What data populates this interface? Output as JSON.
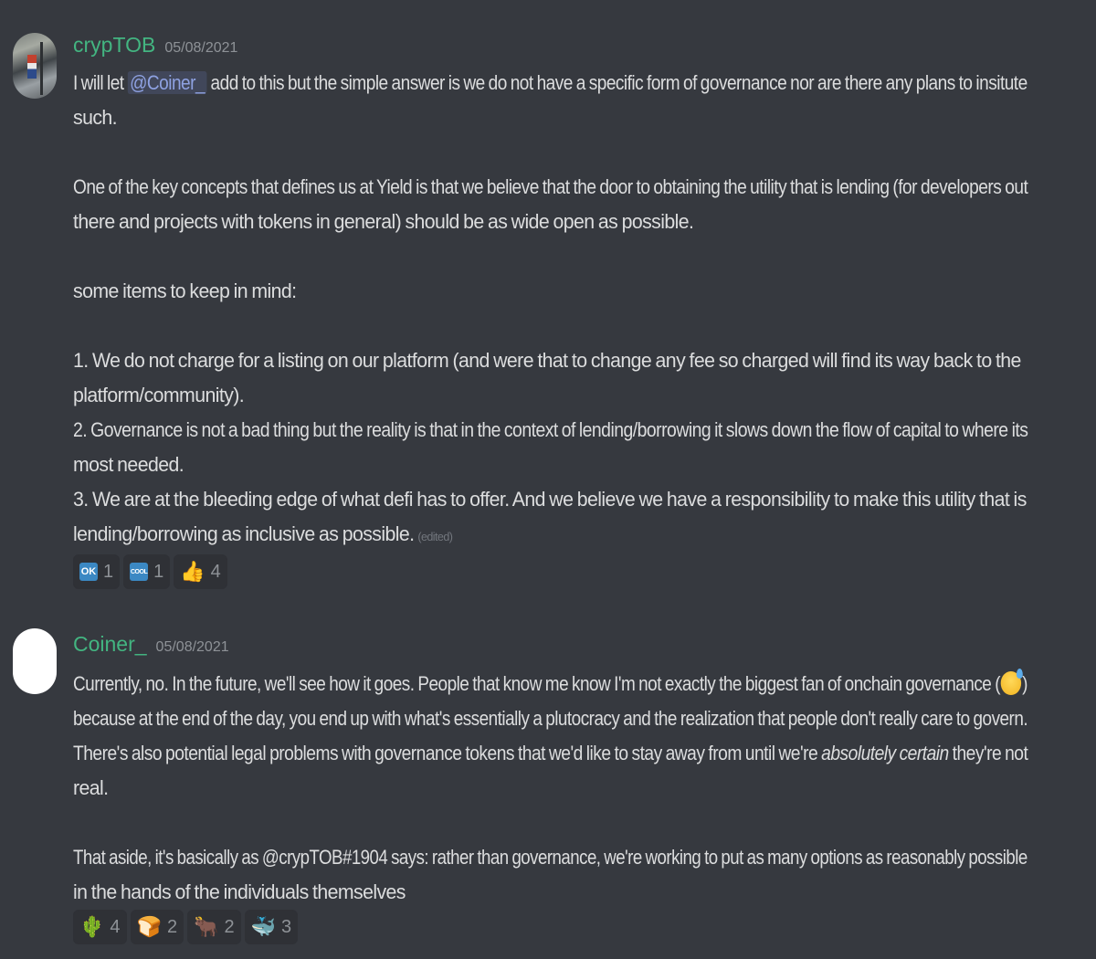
{
  "messages": [
    {
      "username": "crypTOB",
      "timestamp": "05/08/2021",
      "username_color": "#43b581",
      "lines": [
        {
          "pre": "I will let ",
          "mention": "@Coiner_",
          "post": "  add to this but the simple answer is we do not have a specific form of governance nor are there any plans to insitute"
        },
        {
          "text": "such."
        },
        {
          "text": "One of the key concepts that defines us at Yield is that we believe that the door to obtaining the utility that is lending (for developers out"
        },
        {
          "text": "there and projects with tokens in general) should be as wide open as possible."
        },
        {
          "text": "some items to keep in mind:"
        },
        {
          "text": "1. We do not charge for a listing on our platform (and were that to change any fee so charged will find its way back to the"
        },
        {
          "text": "platform/community)."
        },
        {
          "text": "2. Governance is not a bad thing but the reality is that in the context of lending/borrowing it slows down the flow of capital to where its"
        },
        {
          "text": "most needed."
        },
        {
          "text": "3. We are at the bleeding edge of what defi has to offer. And we believe we have a responsibility to make this utility that is"
        },
        {
          "text": "lending/borrowing as inclusive as possible."
        }
      ],
      "edited_label": "(edited)",
      "reactions": [
        {
          "icon": "ok-button-icon",
          "label": "OK",
          "count": "1"
        },
        {
          "icon": "cool-button-icon",
          "label": "COOL",
          "count": "1"
        },
        {
          "icon": "thumbs-up-icon",
          "glyph": "👍",
          "count": "4"
        }
      ]
    },
    {
      "username": "Coiner_",
      "timestamp": "05/08/2021",
      "username_color": "#43b581",
      "lines": [
        {
          "pre": "Currently, no. In the future, we'll see how it goes. People that know me know I'm not exactly the biggest fan of onchain governance (",
          "post": ")"
        },
        {
          "text": "because at the end of the day, you end up with what's essentially a plutocracy and the realization that people don't really care to govern."
        },
        {
          "pre": "There's also potential legal problems with governance tokens that we'd like to stay away from until we're ",
          "italic": "absolutely certain",
          "post": " they're not"
        },
        {
          "text": "real."
        },
        {
          "text": "That aside, it's basically as @crypTOB#1904 says: rather than governance, we're working to put as many options as reasonably possible"
        },
        {
          "text": "in the hands of the individuals themselves"
        }
      ],
      "reactions": [
        {
          "icon": "cactus-icon",
          "glyph": "🌵",
          "count": "4"
        },
        {
          "icon": "bread-icon",
          "glyph": "🍞",
          "count": "2"
        },
        {
          "icon": "ox-icon",
          "glyph": "🐂",
          "count": "2"
        },
        {
          "icon": "whale-icon",
          "glyph": "🐳",
          "count": "3"
        }
      ]
    }
  ]
}
